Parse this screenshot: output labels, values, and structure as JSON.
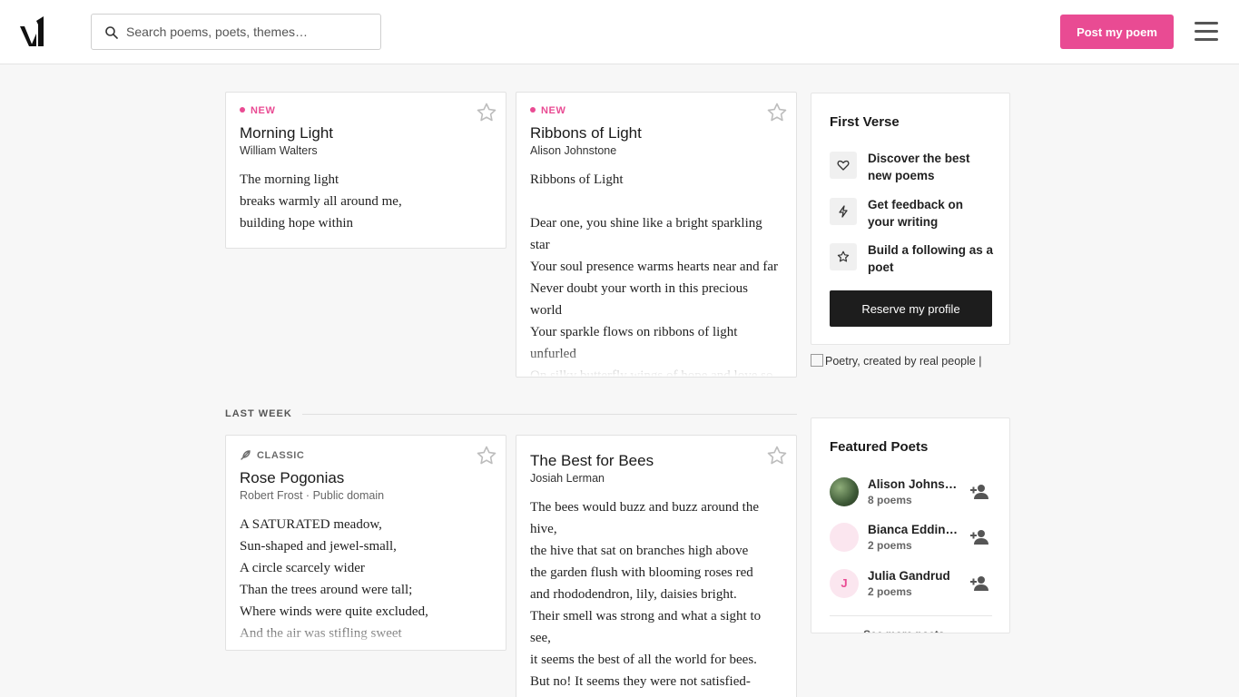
{
  "header": {
    "logo_icon": "v1-logo-icon",
    "search_placeholder": "Search poems, poets, themes…",
    "post_button": "Post my poem",
    "menu_icon": "hamburger-menu-icon",
    "accent_color": "#e94b93"
  },
  "cards": [
    {
      "badge": "NEW",
      "title": "Morning Light",
      "author": "William Walters",
      "lines": [
        "The morning light",
        "breaks warmly all around me,",
        "building hope within"
      ]
    },
    {
      "badge": "NEW",
      "title": "Ribbons of Light",
      "author": "Alison Johnstone",
      "lines": [
        "Ribbons of Light",
        "",
        "Dear one,  you shine like a bright sparkling star",
        "Your soul presence warms hearts near and far",
        "Never doubt your worth in this precious world",
        "Your sparkle flows on ribbons of light unfurled",
        "On silky butterfly wings of hope and love so"
      ]
    },
    {
      "badge": "CLASSIC",
      "title": "Rose Pogonias",
      "author": "Robert Frost · Public domain",
      "lines": [
        "A SATURATED meadow,",
        "Sun-shaped and jewel-small,",
        "A circle scarcely wider",
        "Than the trees around were tall;",
        "Where winds were quite excluded,",
        "And the air was stifling sweet"
      ]
    },
    {
      "title": "The Best for Bees",
      "author": "Josiah Lerman",
      "lines": [
        "The bees would buzz and buzz around the hive,",
        "the hive that sat on branches high above",
        "the garden flush with blooming roses red",
        "and rhododendron, lily, daisies bright.",
        "Their smell was strong and what a sight to see,",
        "it seems the best of all the world for bees.",
        "But no! It seems they were not satisfied-"
      ]
    }
  ],
  "section_label": "LAST WEEK",
  "first_verse": {
    "title": "First Verse",
    "features": [
      {
        "icon": "heart-icon",
        "text": "Discover the best new poems"
      },
      {
        "icon": "lightning-icon",
        "text": "Get feedback on your writing"
      },
      {
        "icon": "star-icon",
        "text": "Build a following as a poet"
      }
    ],
    "button": "Reserve my profile"
  },
  "broken_image_alt": "Poetry, created by real people |",
  "featured": {
    "title": "Featured Poets",
    "poets": [
      {
        "name": "Alison Johnstone",
        "count": "8 poems"
      },
      {
        "name": "Bianca Eddington",
        "count": "2 poems"
      },
      {
        "name": "Julia Gandrud",
        "count": "2 poems",
        "initial": "J"
      }
    ],
    "see_more": "See more poets →"
  }
}
